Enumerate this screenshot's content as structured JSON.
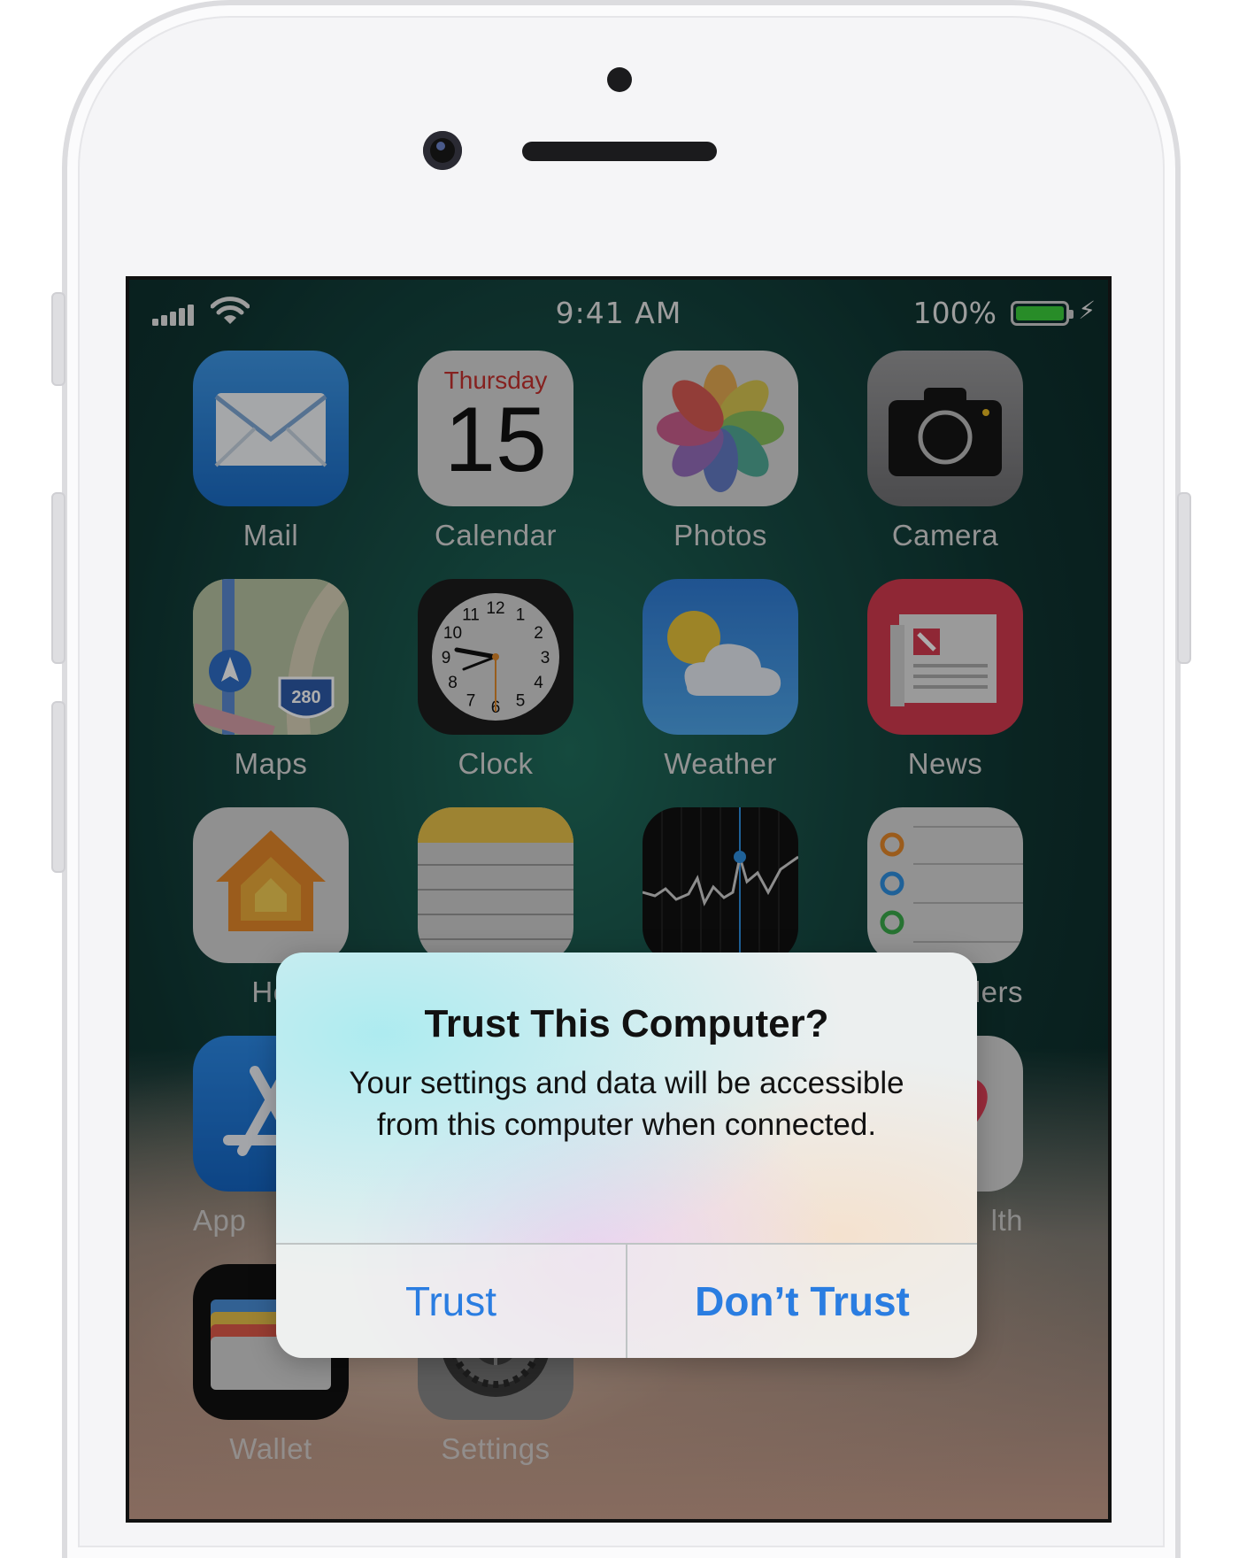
{
  "status_bar": {
    "time": "9:41 AM",
    "battery_percent": "100%",
    "battery_level": 1.0,
    "charging_icon": "bolt-icon",
    "signal_icon": "cellular-signal-icon",
    "wifi_icon": "wifi-icon"
  },
  "apps": [
    {
      "name": "Mail",
      "icon": "mail-icon"
    },
    {
      "name": "Calendar",
      "icon": "calendar-icon",
      "weekday": "Thursday",
      "day": "15"
    },
    {
      "name": "Photos",
      "icon": "photos-icon"
    },
    {
      "name": "Camera",
      "icon": "camera-icon"
    },
    {
      "name": "Maps",
      "icon": "maps-icon",
      "badge": "280"
    },
    {
      "name": "Clock",
      "icon": "clock-icon"
    },
    {
      "name": "Weather",
      "icon": "weather-icon"
    },
    {
      "name": "News",
      "icon": "news-icon"
    },
    {
      "name": "Ho",
      "icon": "home-icon"
    },
    {
      "name": "",
      "icon": "notes-icon"
    },
    {
      "name": "",
      "icon": "stocks-icon"
    },
    {
      "name": "ders",
      "icon": "reminders-icon"
    },
    {
      "name": "App",
      "icon": "app-store-icon"
    },
    {
      "name": "lth",
      "icon": "health-icon"
    },
    {
      "name": "Wallet",
      "icon": "wallet-icon"
    },
    {
      "name": "Settings",
      "icon": "settings-icon"
    }
  ],
  "clock_numbers": [
    "12",
    "1",
    "2",
    "3",
    "4",
    "5",
    "6",
    "7",
    "8",
    "9",
    "10",
    "11"
  ],
  "alert": {
    "title": "Trust This Computer?",
    "message": "Your settings and data will be accessible from this computer when connected.",
    "buttons": {
      "trust": "Trust",
      "dont_trust": "Don’t Trust"
    }
  },
  "colors": {
    "accent": "#2a7de1",
    "battery_fill": "#3ccf3c",
    "calendar_red": "#c4322f"
  }
}
